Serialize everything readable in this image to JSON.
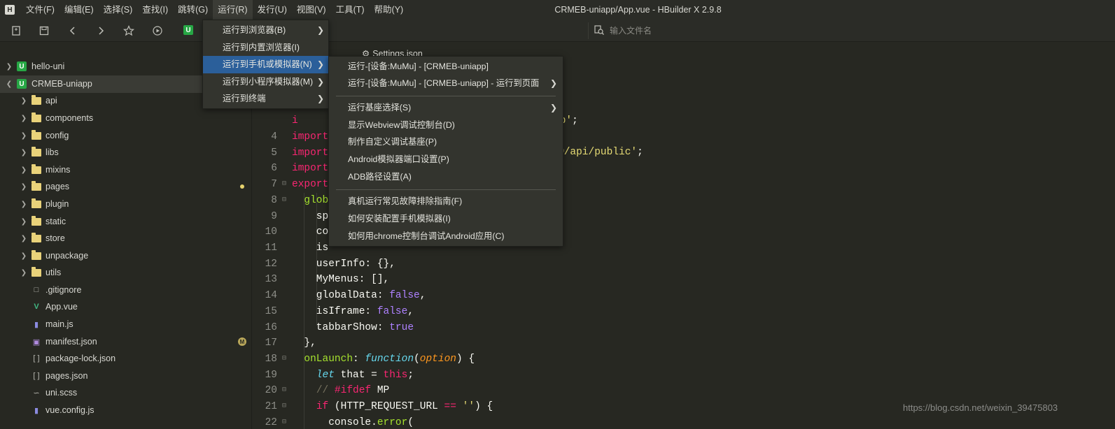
{
  "app": {
    "logo_letter": "H",
    "window_title": "CRMEB-uniapp/App.vue - HBuilder X 2.9.8"
  },
  "menubar": {
    "items": [
      "文件(F)",
      "编辑(E)",
      "选择(S)",
      "查找(I)",
      "跳转(G)",
      "运行(R)",
      "发行(U)",
      "视图(V)",
      "工具(T)",
      "帮助(Y)"
    ]
  },
  "toolbar": {
    "project_letter": "U",
    "search_placeholder": "输入文件名"
  },
  "sidebar": {
    "items": [
      {
        "label": "hello-uni",
        "type": "project"
      },
      {
        "label": "CRMEB-uniapp",
        "type": "project"
      },
      {
        "label": "api",
        "type": "folder"
      },
      {
        "label": "components",
        "type": "folder"
      },
      {
        "label": "config",
        "type": "folder"
      },
      {
        "label": "libs",
        "type": "folder"
      },
      {
        "label": "mixins",
        "type": "folder"
      },
      {
        "label": "pages",
        "type": "folder"
      },
      {
        "label": "plugin",
        "type": "folder"
      },
      {
        "label": "static",
        "type": "folder"
      },
      {
        "label": "store",
        "type": "folder"
      },
      {
        "label": "unpackage",
        "type": "folder"
      },
      {
        "label": "utils",
        "type": "folder"
      },
      {
        "label": ".gitignore",
        "type": "file"
      },
      {
        "label": "App.vue",
        "type": "vue"
      },
      {
        "label": "main.js",
        "type": "js"
      },
      {
        "label": "manifest.json",
        "type": "json"
      },
      {
        "label": "package-lock.json",
        "type": "brackets"
      },
      {
        "label": "pages.json",
        "type": "brackets"
      },
      {
        "label": "uni.scss",
        "type": "scss"
      },
      {
        "label": "vue.config.js",
        "type": "js"
      }
    ],
    "modified_badge": "M"
  },
  "editor": {
    "tab_label": "Settings.json"
  },
  "run_menu": {
    "items": [
      {
        "label": "运行到浏览器(B)",
        "submenu": true
      },
      {
        "label": "运行到内置浏览器(I)",
        "submenu": false
      },
      {
        "label": "运行到手机或模拟器(N)",
        "submenu": true
      },
      {
        "label": "运行到小程序模拟器(M)",
        "submenu": true
      },
      {
        "label": "运行到终端",
        "submenu": true
      }
    ]
  },
  "device_menu": {
    "items": [
      {
        "label": "运行-[设备:MuMu] - [CRMEB-uniapp]",
        "submenu": false
      },
      {
        "label": "运行-[设备:MuMu] - [CRMEB-uniapp] - 运行到页面",
        "submenu": true
      },
      {
        "label": "运行基座选择(S)",
        "submenu": true
      },
      {
        "label": "显示Webview调试控制台(D)",
        "submenu": false
      },
      {
        "label": "制作自定义调试基座(P)",
        "submenu": false
      },
      {
        "label": "Android模拟器端口设置(P)",
        "submenu": false
      },
      {
        "label": "ADB路径设置(A)",
        "submenu": false
      },
      {
        "label": "真机运行常见故障排除指南(F)",
        "submenu": false
      },
      {
        "label": "如何安装配置手机模拟器(I)",
        "submenu": false
      },
      {
        "label": "如何用chrome控制台调试Android应用(C)",
        "submenu": false
      }
    ]
  },
  "watermark": "https://blog.csdn.net/weixin_39475803"
}
